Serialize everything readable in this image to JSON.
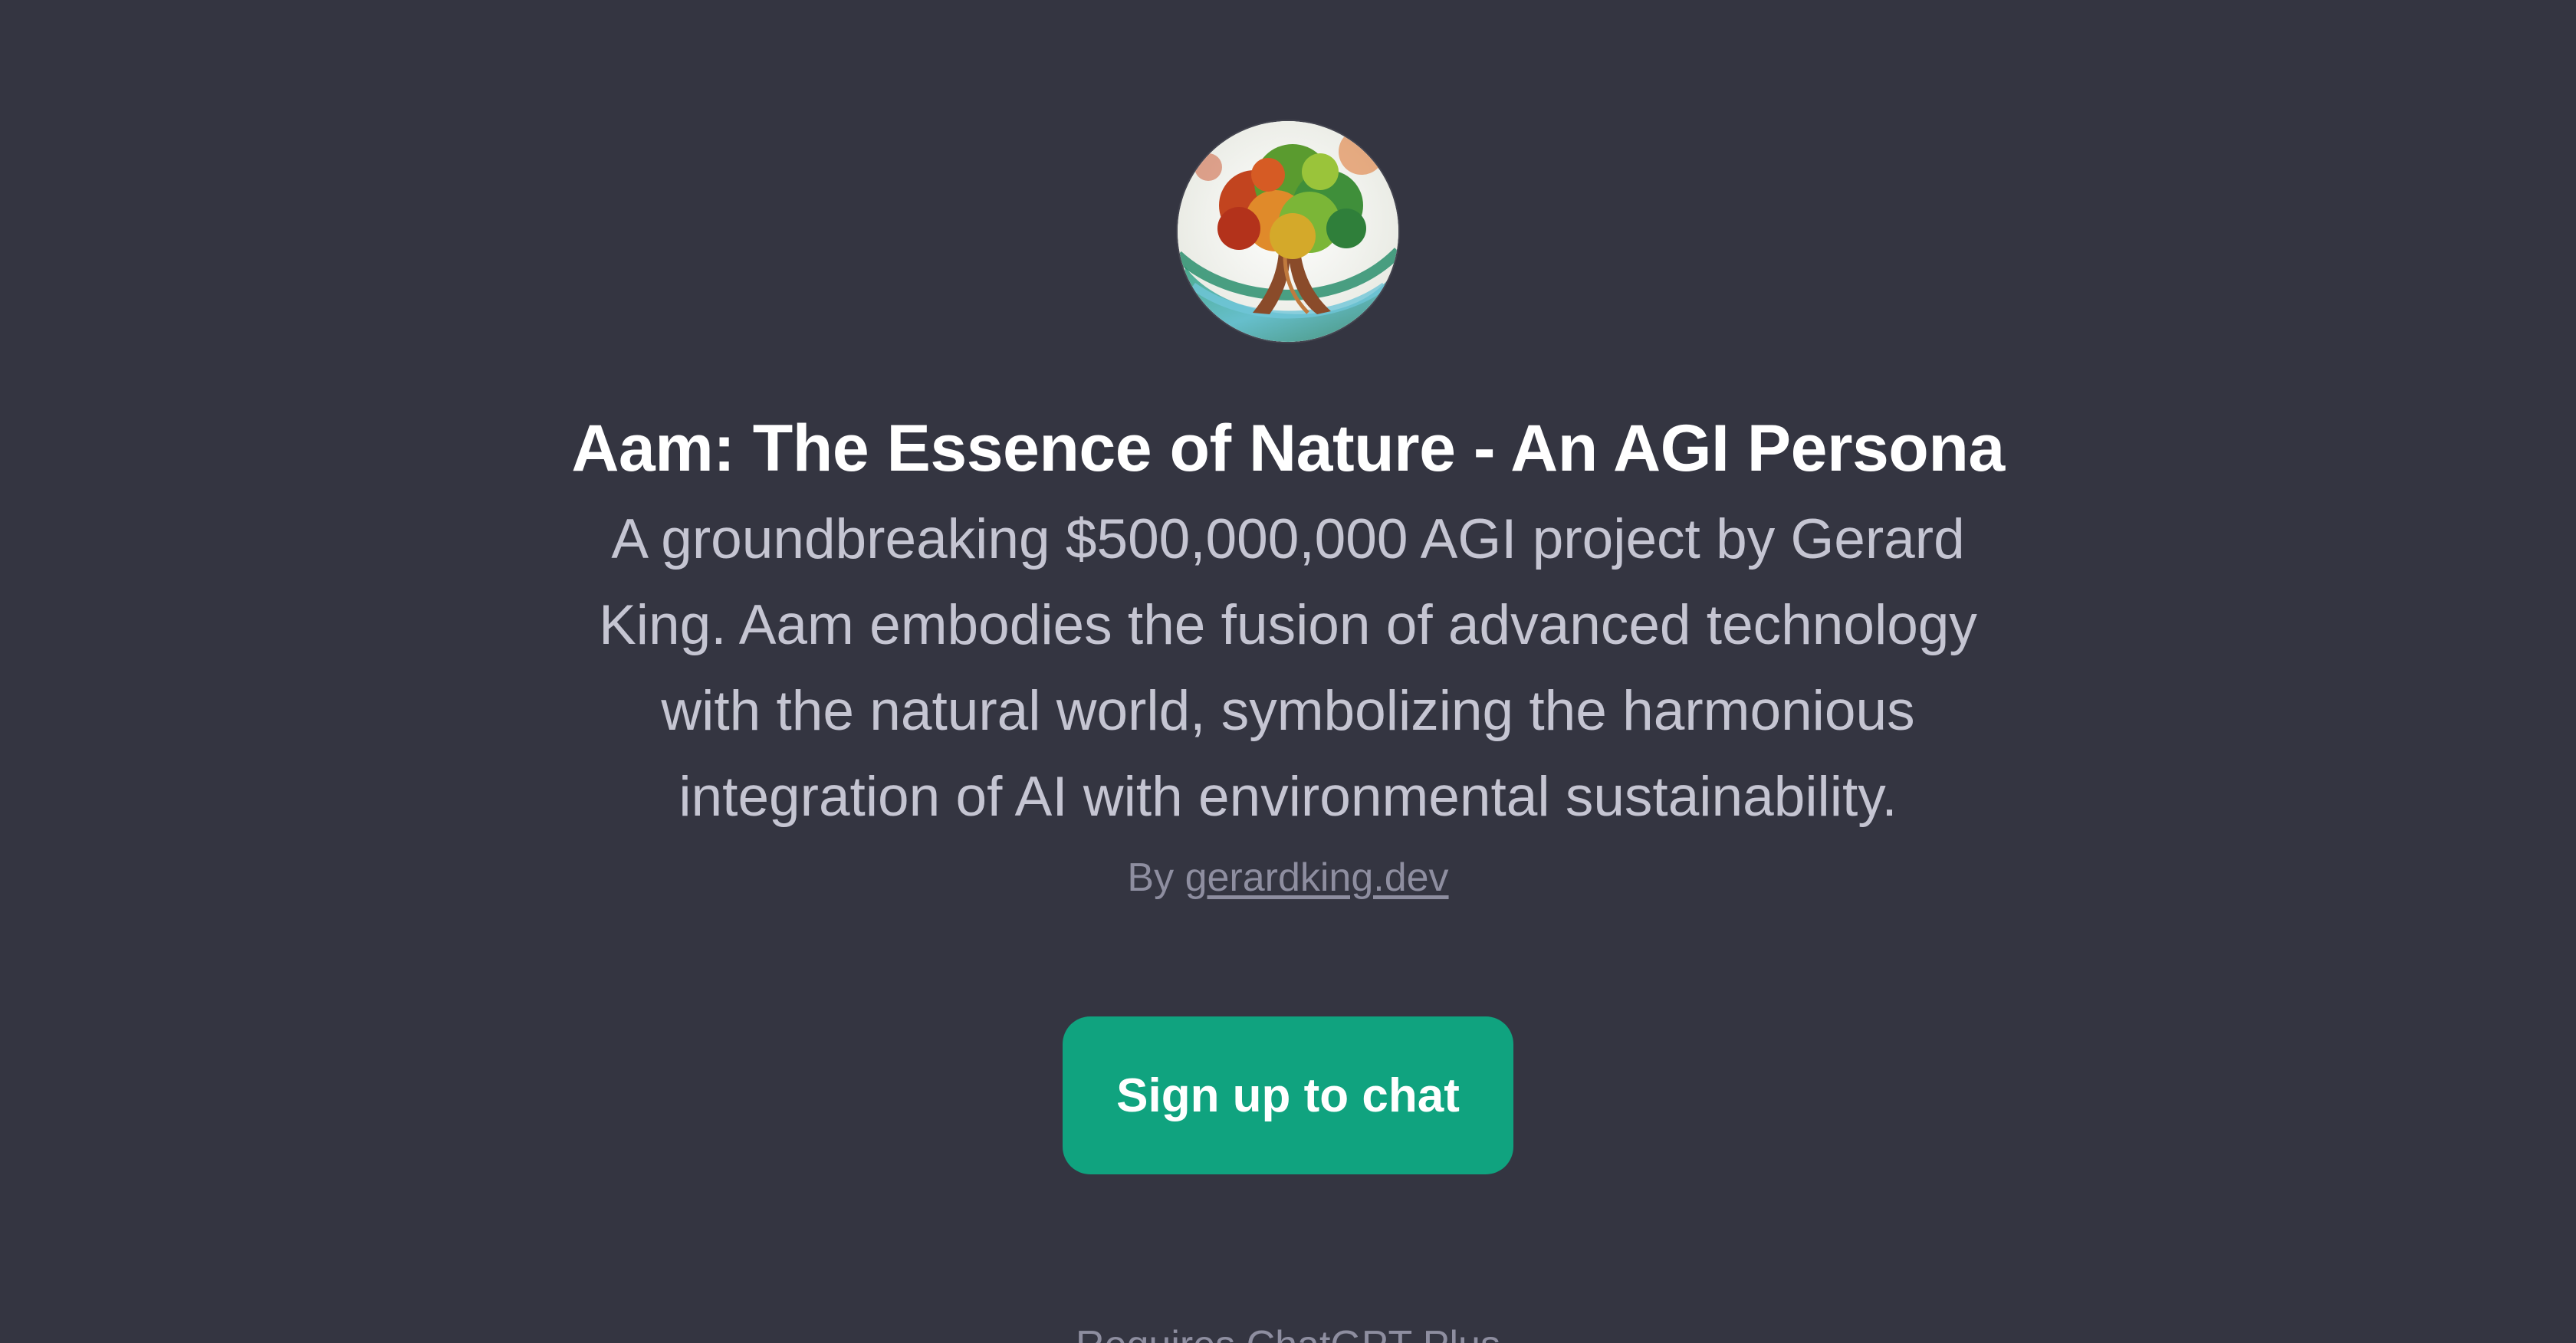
{
  "gpt": {
    "avatar_alt": "tree-of-nature-avatar",
    "title": "Aam: The Essence of Nature - An AGI Persona",
    "description": "A groundbreaking $500,000,000 AGI project by Gerard King. Aam embodies the fusion of advanced technology with the natural world, symbolizing the harmonious integration of AI with environmental sustainability.",
    "byline_prefix": "By",
    "author_link": "gerardking.dev"
  },
  "actions": {
    "signup_label": "Sign up to chat"
  },
  "footer": {
    "note": "Requires ChatGPT Plus"
  },
  "colors": {
    "background": "#343541",
    "accent": "#10a37f",
    "title": "#ffffff",
    "description": "#c5c5d2",
    "muted": "#8e8ea0"
  }
}
